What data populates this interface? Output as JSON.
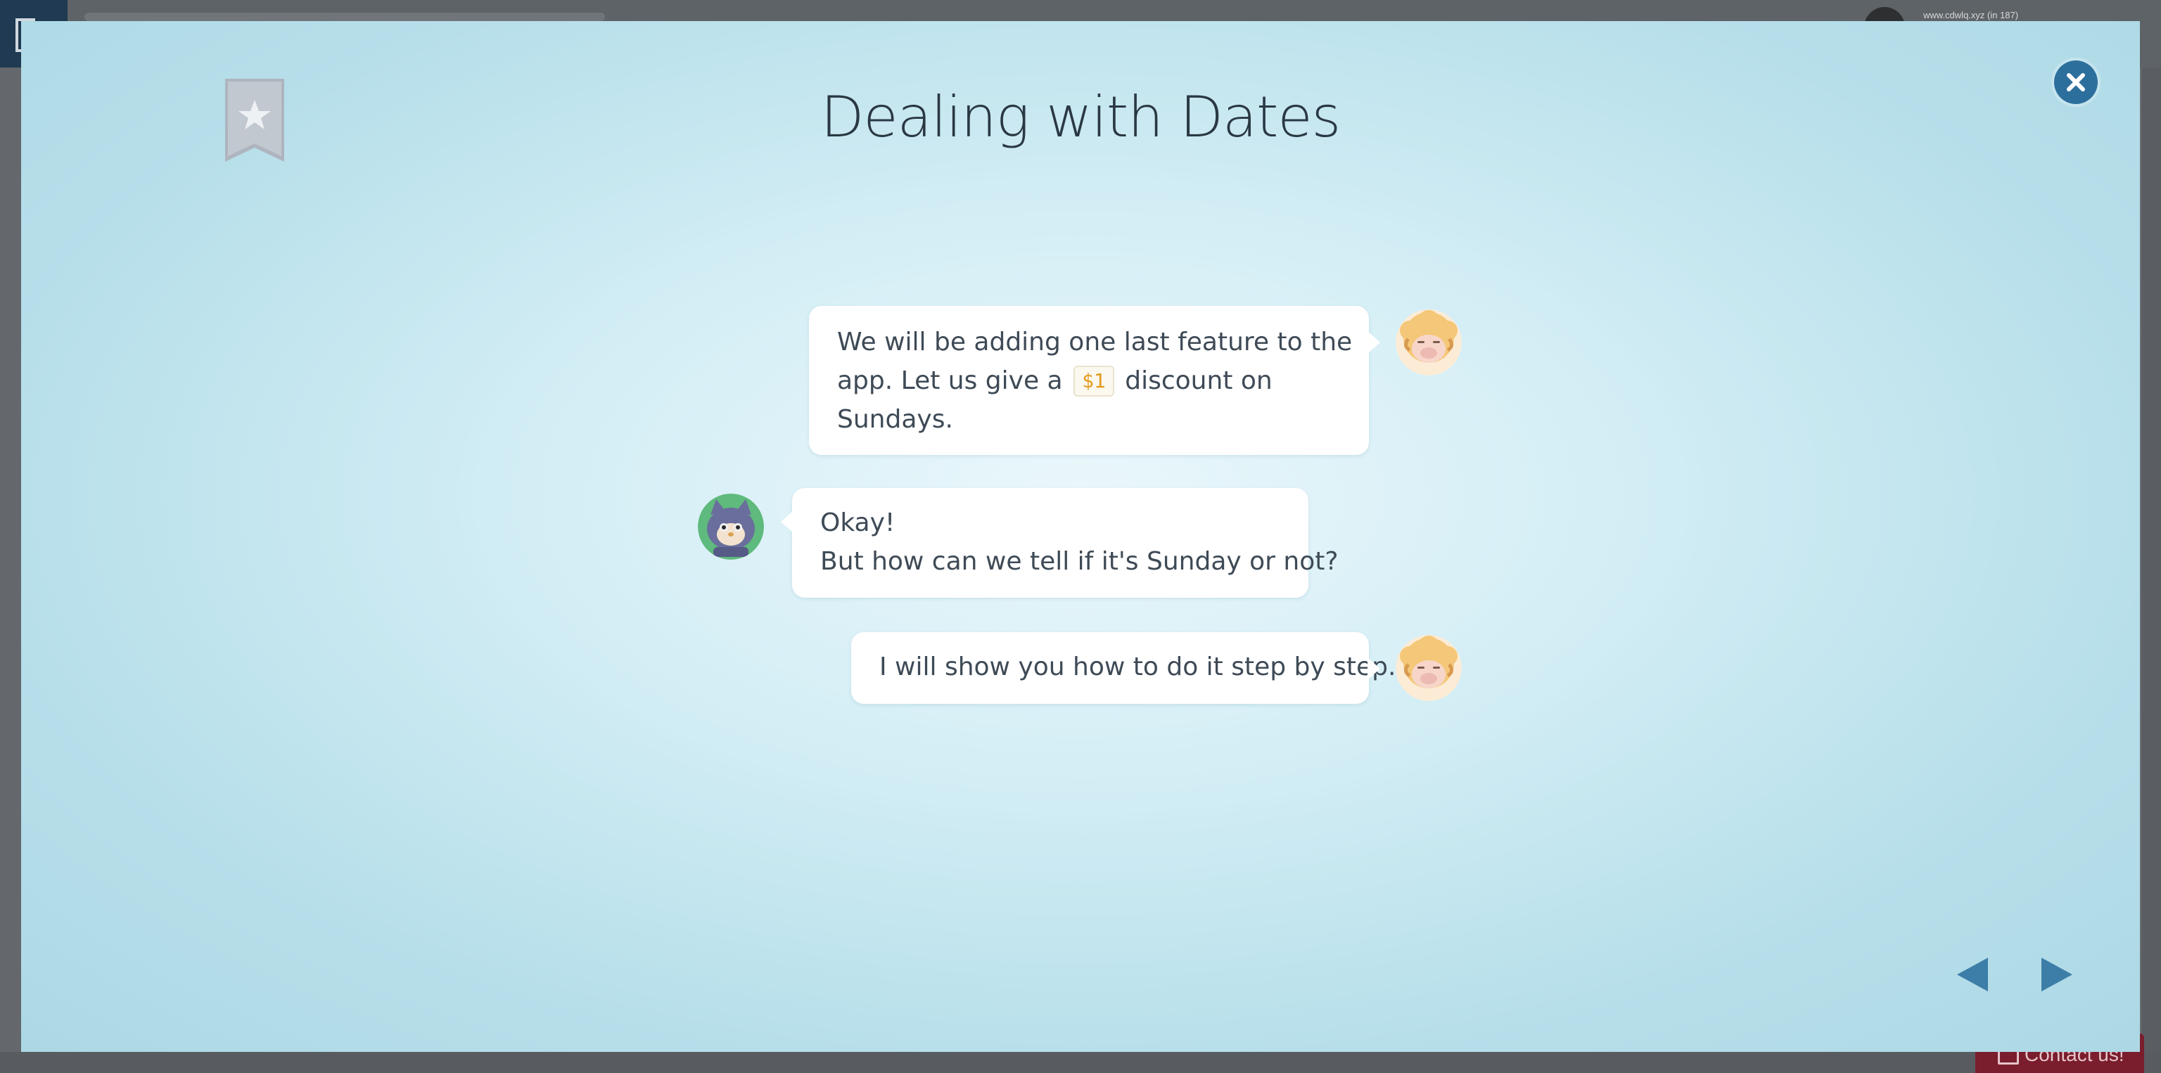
{
  "background": {
    "username": "www.cdwlq.xyz (in 187)",
    "contact_label": "Contact us!"
  },
  "modal": {
    "title": "Dealing with Dates",
    "colors": {
      "accent": "#2d6f9c",
      "nav_arrow": "#3d7ea8",
      "title_text": "#2a3843",
      "bubble_text": "#3e4a56",
      "code_text": "#e39b1e"
    },
    "messages": [
      {
        "speaker": "sheep",
        "side": "right",
        "lines": [
          "We will be adding one last feature to the",
          "app. Let us give a",
          "discount on",
          "Sundays."
        ],
        "code": "$1"
      },
      {
        "speaker": "cat",
        "side": "left",
        "lines": [
          "Okay!",
          "But how can we tell if it's Sunday or not?"
        ]
      },
      {
        "speaker": "sheep",
        "side": "right",
        "lines": [
          "I will show you how to do it step by step."
        ]
      }
    ],
    "icons": {
      "bookmark": "bookmark-star-icon",
      "close": "close-icon",
      "prev": "arrow-left-icon",
      "next": "arrow-right-icon"
    }
  }
}
